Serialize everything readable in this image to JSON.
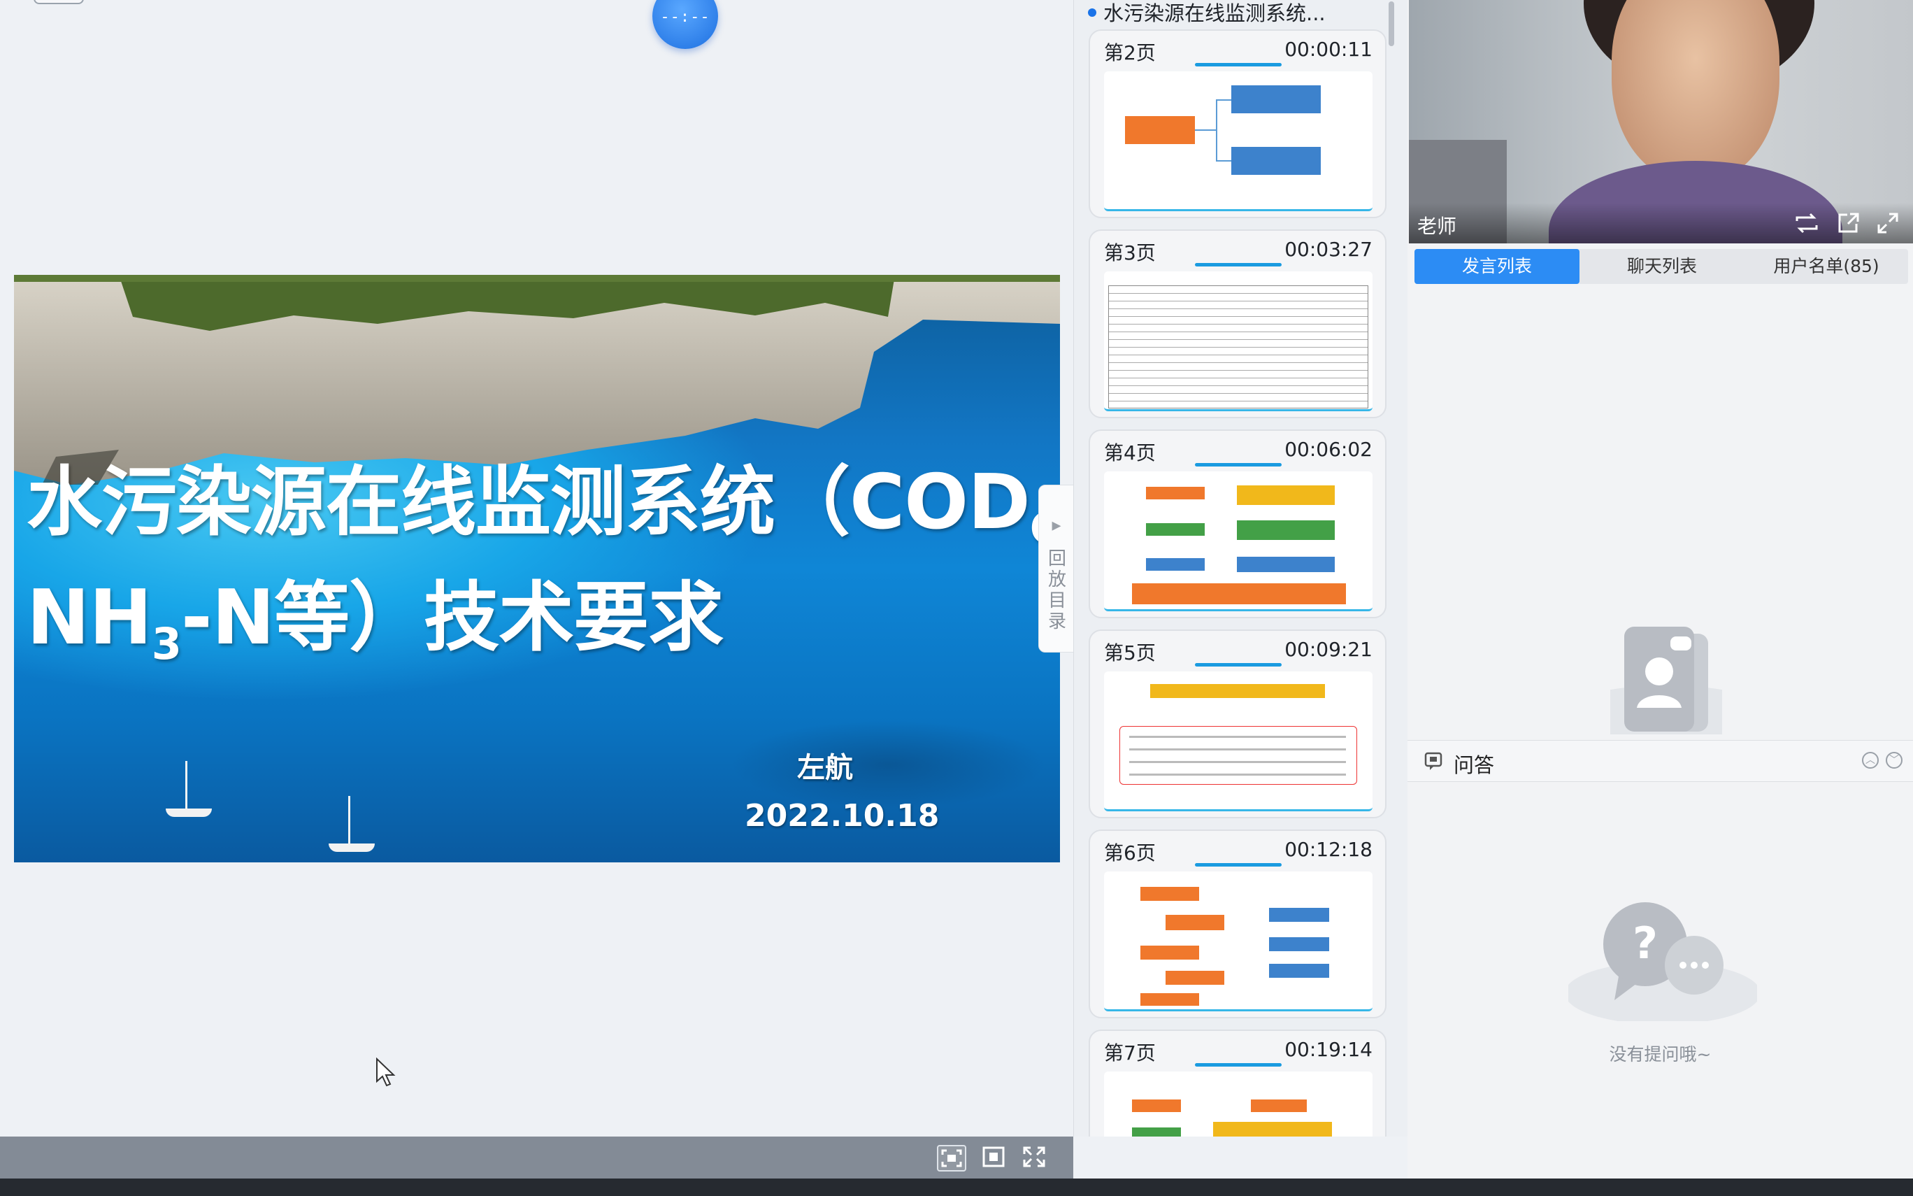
{
  "stage": {
    "timer_text": "--:--",
    "slide": {
      "title_line1": "水污染源在线监测系统（COD",
      "title_sub1": "Cr",
      "title_line2_a": "NH",
      "title_sub2": "3",
      "title_line2_b": "-N等）技术要求",
      "author": "左航",
      "date": "2022.10.18"
    }
  },
  "directory": {
    "toggle_label": "回放目录",
    "title": "水污染源在线监测系统...",
    "items": [
      {
        "page": "第2页",
        "time": "00:00:11"
      },
      {
        "page": "第3页",
        "time": "00:03:27"
      },
      {
        "page": "第4页",
        "time": "00:06:02"
      },
      {
        "page": "第5页",
        "time": "00:09:21"
      },
      {
        "page": "第6页",
        "time": "00:12:18"
      },
      {
        "page": "第7页",
        "time": "00:19:14"
      }
    ]
  },
  "video": {
    "speaker_name": "老师"
  },
  "tabs": {
    "speakers": "发言列表",
    "chat": "聊天列表",
    "users": "用户名单(85)"
  },
  "qa": {
    "title": "问答",
    "empty_text": "没有提问哦~"
  },
  "colors": {
    "accent": "#2c8cf4",
    "card_progress": "#1a9be0"
  },
  "icons": [
    "fit-screen-icon",
    "fit-width-icon",
    "fullscreen-icon",
    "switch-camera-icon",
    "popout-icon",
    "expand-icon",
    "qa-icon",
    "collapse-up-icon",
    "collapse-down-icon"
  ]
}
